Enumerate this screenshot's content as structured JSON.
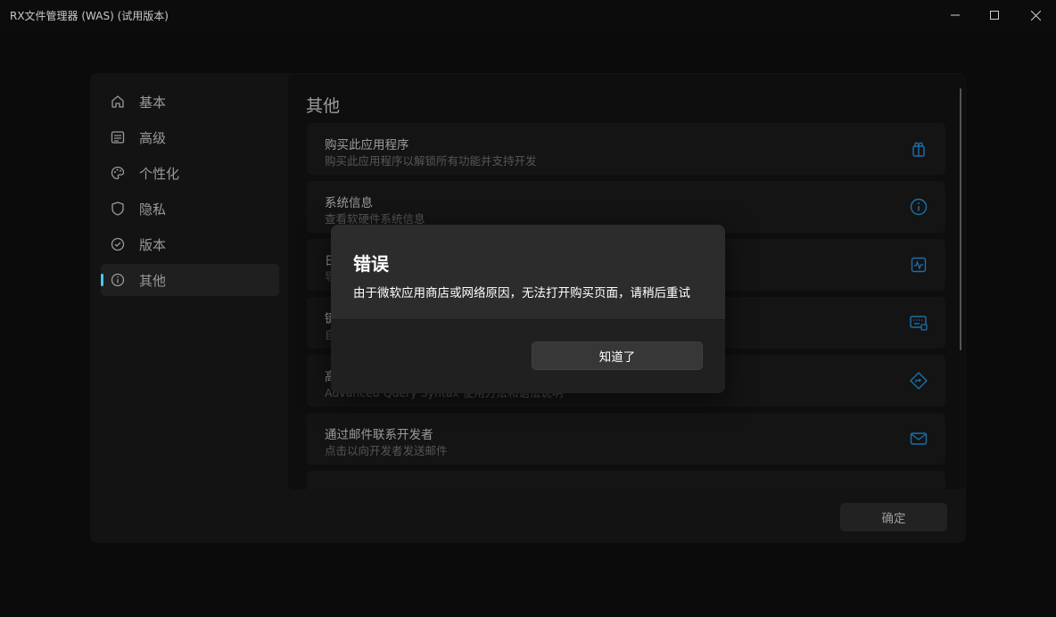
{
  "window": {
    "title": "RX文件管理器 (WAS) (试用版本)",
    "controls": [
      "minimize-icon",
      "maximize-icon",
      "close-icon"
    ]
  },
  "settings": {
    "nav": [
      {
        "label": "基本",
        "icon": "home-icon"
      },
      {
        "label": "高级",
        "icon": "advanced-settings-icon"
      },
      {
        "label": "个性化",
        "icon": "palette-icon"
      },
      {
        "label": "隐私",
        "icon": "shield-icon"
      },
      {
        "label": "版本",
        "icon": "check-circle-icon"
      },
      {
        "label": "其他",
        "icon": "info-icon",
        "selected": true
      }
    ],
    "page_title": "其他",
    "cards": [
      {
        "title": "购买此应用程序",
        "subtitle": "购买此应用程序以解锁所有功能并支持开发",
        "icon": "gift-icon"
      },
      {
        "title": "系统信息",
        "subtitle": "查看软硬件系统信息",
        "icon": "info-icon"
      },
      {
        "title": "日",
        "subtitle": "导",
        "icon": "activity-icon"
      },
      {
        "title": "键",
        "subtitle": "自",
        "icon": "keyboard-icon"
      },
      {
        "title": "高",
        "subtitle": "Advanced Query Syntax 使用方法和语法说明",
        "icon": "directions-icon"
      },
      {
        "title": "通过邮件联系开发者",
        "subtitle": "点击以向开发者发送邮件",
        "icon": "mail-icon"
      }
    ],
    "confirm_label": "确定"
  },
  "error_dialog": {
    "title": "错误",
    "message": "由于微软应用商店或网络原因，无法打开购买页面，请稍后重试",
    "button_label": "知道了"
  },
  "colors": {
    "accent": "#4cc2ff",
    "icon_blue": "#1c6fa8",
    "background": "#0b0b0b",
    "modal": "#2c2c2c"
  }
}
